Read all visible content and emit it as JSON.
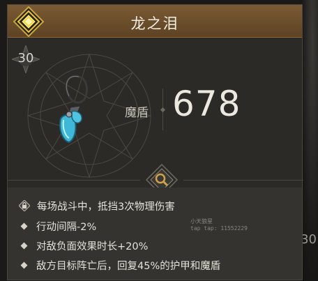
{
  "item": {
    "name": "龙之泪",
    "level": "30"
  },
  "stat": {
    "label": "魔盾",
    "value": "678"
  },
  "effects": [
    "每场战斗中，抵挡3次物理伤害",
    "行动间隔-2%",
    "对敌负面效果时长+20%",
    "敌方目标阵亡后，回复45%的护甲和魔盾"
  ],
  "watermark": {
    "line1": "小天狼星",
    "line2": "tap tap: 11552229"
  },
  "background": {
    "right_edge_number": "30"
  },
  "icons": {
    "rank": "gold-diamond-icon",
    "level": "star-badge-icon",
    "item": "teardrop-pendant-icon",
    "inspect": "magnifier-icon",
    "first_effect": "lock-icon"
  },
  "colors": {
    "title_bar": "#6b4d2a",
    "card_bg": "#2b2a27",
    "effects_bg": "#343330",
    "gem": "#4fc3e0",
    "rank_gold": "#e8c53a"
  }
}
